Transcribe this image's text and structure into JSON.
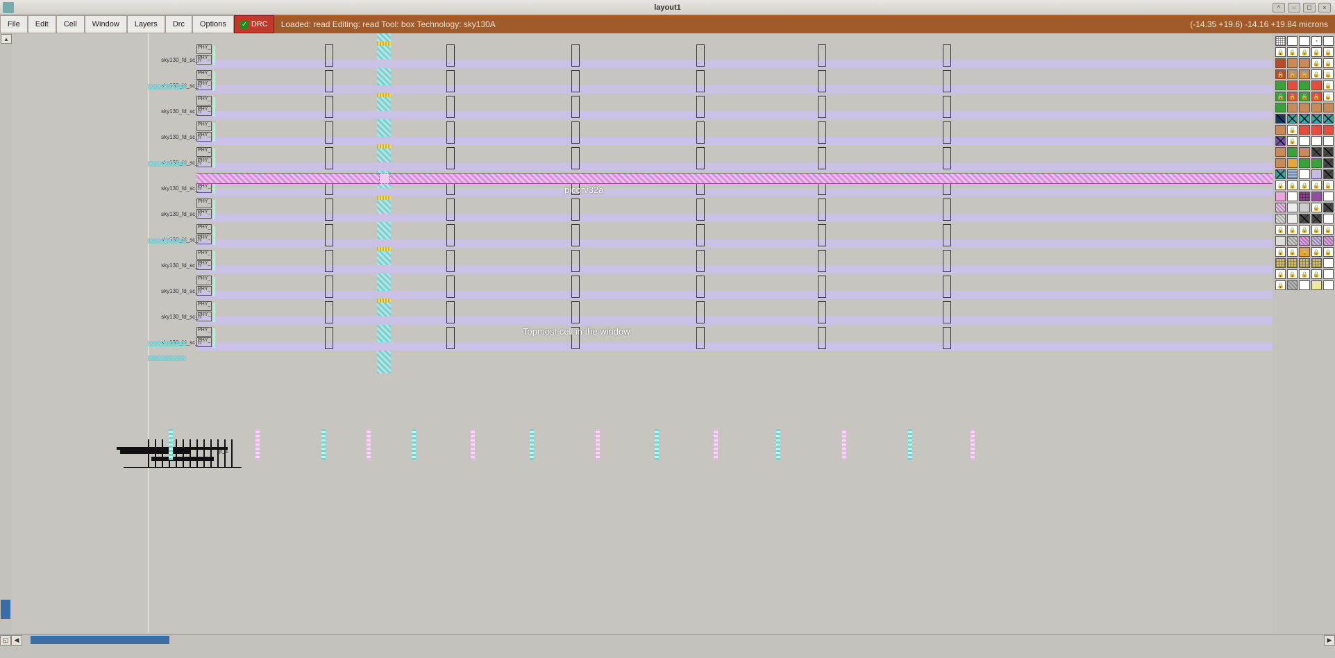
{
  "window": {
    "title": "layout1"
  },
  "menu": {
    "items": [
      "File",
      "Edit",
      "Cell",
      "Window",
      "Layers",
      "Drc",
      "Options"
    ],
    "drc_label": "DRC"
  },
  "status": {
    "left": "Loaded: read Editing: read Tool: box  Technology: sky130A",
    "right": "(-14.35 +19.6) -14.16 +19.84 microns"
  },
  "annotations": {
    "design": "picorv32a",
    "topcell": "Topmost cell in the window",
    "small_tag": "jt_1"
  },
  "cells": {
    "row_label": "sky130_fd_sc_h",
    "phy_label": "PHY_",
    "rows": [
      0,
      1,
      2,
      3,
      4,
      5,
      6,
      7,
      8,
      9,
      10,
      11
    ],
    "hatched_left_rows": [
      1,
      4,
      7,
      11
    ],
    "tallbox_cols_x": [
      450,
      625,
      805,
      985,
      1160,
      1340
    ],
    "tick_bottom_x": [
      225,
      350,
      445,
      510,
      575,
      660,
      745,
      840,
      925,
      1010,
      1100,
      1195,
      1290,
      1380
    ]
  },
  "palette_rows": [
    [
      {
        "bg": "#fff",
        "p": "grid"
      },
      {
        "bg": "#fff"
      },
      {
        "bg": "#fff",
        "p": "box"
      },
      {
        "bg": "#fff",
        "p": "dotbox"
      },
      {
        "bg": "#fff"
      }
    ],
    [
      {
        "bg": "#fff",
        "lock": true
      },
      {
        "bg": "#fff",
        "lock": true
      },
      {
        "bg": "#fff",
        "lock": true
      },
      {
        "bg": "#fff",
        "lock": true
      },
      {
        "bg": "#fff",
        "lock": true
      }
    ],
    [
      {
        "bg": "#b94a2d"
      },
      {
        "bg": "#c98a58"
      },
      {
        "bg": "#c98a58"
      },
      {
        "bg": "#fff",
        "lock": true
      },
      {
        "bg": "#fff",
        "lock": true
      }
    ],
    [
      {
        "bg": "#b94a2d",
        "lock": true
      },
      {
        "bg": "#c98a58",
        "lock": true
      },
      {
        "bg": "#c98a58",
        "lock": true
      },
      {
        "bg": "#fff",
        "lock": true
      },
      {
        "bg": "#fff",
        "lock": true
      }
    ],
    [
      {
        "bg": "#3aa23a"
      },
      {
        "bg": "#e84b3c"
      },
      {
        "bg": "#3aa23a"
      },
      {
        "bg": "#e84b3c"
      },
      {
        "bg": "#fff",
        "lock": true
      }
    ],
    [
      {
        "bg": "#3aa23a",
        "lock": true
      },
      {
        "bg": "#e84b3c",
        "lock": true
      },
      {
        "bg": "#3aa23a",
        "lock": true
      },
      {
        "bg": "#e84b3c",
        "lock": true
      },
      {
        "bg": "#fff",
        "lock": true
      }
    ],
    [
      {
        "bg": "#3aa23a"
      },
      {
        "bg": "#c98a58"
      },
      {
        "bg": "#c98a58"
      },
      {
        "bg": "#c98a58"
      },
      {
        "bg": "#c98a58"
      }
    ],
    [
      {
        "bg": "#437aa0",
        "p": "x"
      },
      {
        "bg": "#6fcfcf",
        "p": "x"
      },
      {
        "bg": "#6fcfcf",
        "p": "x"
      },
      {
        "bg": "#6fcfcf",
        "p": "x"
      },
      {
        "bg": "#6fcfcf",
        "p": "x"
      }
    ],
    [
      {
        "bg": "#c98a58"
      },
      {
        "bg": "#fff",
        "lock": true
      },
      {
        "bg": "#e84b3c"
      },
      {
        "bg": "#e84b3c"
      },
      {
        "bg": "#e84b3c"
      }
    ],
    [
      {
        "bg": "#b090d0",
        "p": "x"
      },
      {
        "bg": "#fff",
        "lock": true
      },
      {
        "bg": "#fff"
      },
      {
        "bg": "#fff"
      },
      {
        "bg": "#fff"
      }
    ],
    [
      {
        "bg": "#c98a58"
      },
      {
        "bg": "#3aa23a"
      },
      {
        "bg": "#c98a58"
      },
      {
        "bg": "#888",
        "p": "x"
      },
      {
        "bg": "#888",
        "p": "x"
      }
    ],
    [
      {
        "bg": "#c98a58"
      },
      {
        "bg": "#e6a63a"
      },
      {
        "bg": "#3aa23a"
      },
      {
        "bg": "#3aa23a"
      },
      {
        "bg": "#888",
        "p": "x"
      }
    ],
    [
      {
        "bg": "#6fcfcf",
        "p": "x"
      },
      {
        "bg": "#9fb9e0",
        "p": "hz"
      },
      {
        "bg": "#fff"
      },
      {
        "bg": "#c8b8e6"
      },
      {
        "bg": "#888",
        "p": "x"
      }
    ],
    [
      {
        "bg": "#fff",
        "lock": true
      },
      {
        "bg": "#fff",
        "lock": true
      },
      {
        "bg": "#fff",
        "lock": true
      },
      {
        "bg": "#fff",
        "lock": true
      },
      {
        "bg": "#fff",
        "lock": true
      }
    ],
    [
      {
        "bg": "#e8a5e0"
      },
      {
        "bg": "#fff"
      },
      {
        "bg": "#c080c0",
        "p": "sq"
      },
      {
        "bg": "#9050a0"
      },
      {
        "bg": "#fff"
      }
    ],
    [
      {
        "bg": "#eac0e8",
        "p": "d"
      },
      {
        "bg": "#eee"
      },
      {
        "bg": "#ccc"
      },
      {
        "bg": "#fff",
        "lock": true
      },
      {
        "bg": "#888",
        "p": "x"
      }
    ],
    [
      {
        "bg": "#ddd",
        "p": "d"
      },
      {
        "bg": "#eee"
      },
      {
        "bg": "#888",
        "p": "x"
      },
      {
        "bg": "#888",
        "p": "x"
      },
      {
        "bg": "#fff"
      }
    ],
    [
      {
        "bg": "#fff",
        "lock": true
      },
      {
        "bg": "#fff",
        "lock": true
      },
      {
        "bg": "#fff",
        "lock": true
      },
      {
        "bg": "#fff",
        "lock": true
      },
      {
        "bg": "#fff",
        "lock": true
      }
    ],
    [
      {
        "bg": "#ddd"
      },
      {
        "bg": "#ccc",
        "p": "d"
      },
      {
        "bg": "#e0a0e8",
        "p": "d"
      },
      {
        "bg": "#c8b8e6",
        "p": "d"
      },
      {
        "bg": "#e0a0e8",
        "p": "d"
      }
    ],
    [
      {
        "bg": "#fff",
        "lock": true
      },
      {
        "bg": "#fff",
        "lock": true
      },
      {
        "bg": "#e6a63a",
        "lock": true
      },
      {
        "bg": "#fff",
        "lock": true
      },
      {
        "bg": "#fff",
        "lock": true
      }
    ],
    [
      {
        "bg": "#e6dca0",
        "p": "sq"
      },
      {
        "bg": "#e6dca0",
        "p": "sq"
      },
      {
        "bg": "#e6dca0",
        "p": "sq"
      },
      {
        "bg": "#e6dca0",
        "p": "sq"
      },
      {
        "bg": "#fff"
      }
    ],
    [
      {
        "bg": "#fff",
        "lock": true
      },
      {
        "bg": "#fff",
        "lock": true
      },
      {
        "bg": "#fff",
        "lock": true
      },
      {
        "bg": "#fff",
        "lock": true
      },
      {
        "bg": "#fff"
      }
    ],
    [
      {
        "bg": "#fff",
        "lock": true
      },
      {
        "bg": "#bbb",
        "p": "d"
      },
      {
        "bg": "#fff"
      },
      {
        "bg": "#ece8a0"
      },
      {
        "bg": "#fff"
      }
    ]
  ]
}
